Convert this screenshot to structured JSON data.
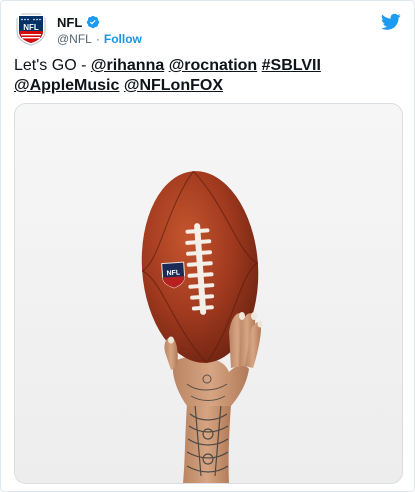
{
  "account": {
    "name": "NFL",
    "handle": "@NFL",
    "follow_label": "Follow",
    "logo_text": "NFL"
  },
  "tweet": {
    "text_lead": "Let's GO - ",
    "mentions": [
      "@rihanna",
      "@rocnation",
      "#SBLVII",
      "@AppleMusic",
      "@NFLonFOX"
    ]
  },
  "media": {
    "description_icon": "photo",
    "ball_logo_text": "NFL"
  },
  "colors": {
    "twitter_blue": "#1d9bf0",
    "follow_blue": "#1b95e0",
    "nfl_navy": "#013369",
    "nfl_red": "#d50a0a",
    "ball_brown": "#a23a1f"
  }
}
